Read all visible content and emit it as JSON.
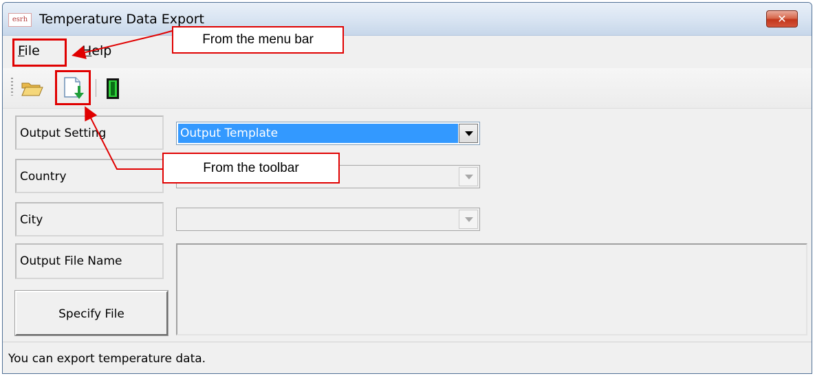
{
  "window": {
    "title": "Temperature Data Export",
    "close_glyph": "✕",
    "app_icon_text": "esrh"
  },
  "menu": {
    "file": "File",
    "help": "Help",
    "file_accel": "F",
    "help_accel": "H"
  },
  "toolbar": {
    "items": [
      {
        "name": "open-folder-icon"
      },
      {
        "name": "export-document-icon"
      },
      {
        "name": "exit-door-icon"
      }
    ]
  },
  "form": {
    "output_setting_label": "Output Setting",
    "output_setting_value": "Output Template",
    "country_label": "Country",
    "country_value": "",
    "city_label": "City",
    "city_value": "",
    "output_file_name_label": "Output File Name",
    "output_file_name_value": "",
    "specify_file_button": "Specify File"
  },
  "status": {
    "text": "You can export temperature data."
  },
  "annotations": {
    "menu_callout": "From the menu bar",
    "toolbar_callout": "From the toolbar",
    "highlight_color": "#e00000"
  }
}
